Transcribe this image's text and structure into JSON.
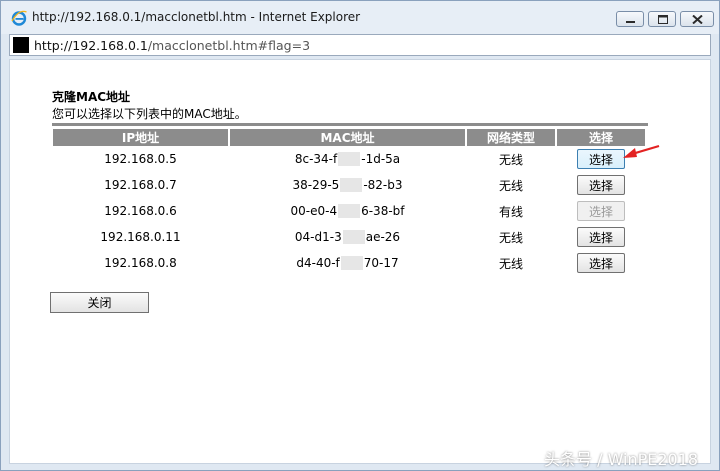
{
  "window": {
    "title": "http://192.168.0.1/macclonetbl.htm - Internet Explorer",
    "address": {
      "host": "http://192.168.0.1",
      "path": "/macclonetbl.htm#flag=3"
    }
  },
  "page": {
    "heading": "克隆MAC地址",
    "description": "您可以选择以下列表中的MAC地址。",
    "columns": {
      "ip": "IP地址",
      "mac": "MAC地址",
      "type": "网络类型",
      "select": "选择"
    },
    "rows": [
      {
        "ip": "192.168.0.5",
        "mac_start": "8c-34-f",
        "mac_end": "-1d-5a",
        "type": "无线",
        "select_label": "选择",
        "enabled": true,
        "hover": true
      },
      {
        "ip": "192.168.0.7",
        "mac_start": "38-29-5",
        "mac_end": "-82-b3",
        "type": "无线",
        "select_label": "选择",
        "enabled": true
      },
      {
        "ip": "192.168.0.6",
        "mac_start": "00-e0-4",
        "mac_end": "6-38-bf",
        "type": "有线",
        "select_label": "选择",
        "enabled": false
      },
      {
        "ip": "192.168.0.11",
        "mac_start": "04-d1-3",
        "mac_end": "ae-26",
        "type": "无线",
        "select_label": "选择",
        "enabled": true
      },
      {
        "ip": "192.168.0.8",
        "mac_start": "d4-40-f",
        "mac_end": "70-17",
        "type": "无线",
        "select_label": "选择",
        "enabled": true
      }
    ],
    "close_label": "关闭"
  },
  "watermark": "头条号 / WinPE2018",
  "colors": {
    "header_gray": "#8c8c8c",
    "arrow_red": "#e32222",
    "ie_blue": "#1e88d6"
  }
}
